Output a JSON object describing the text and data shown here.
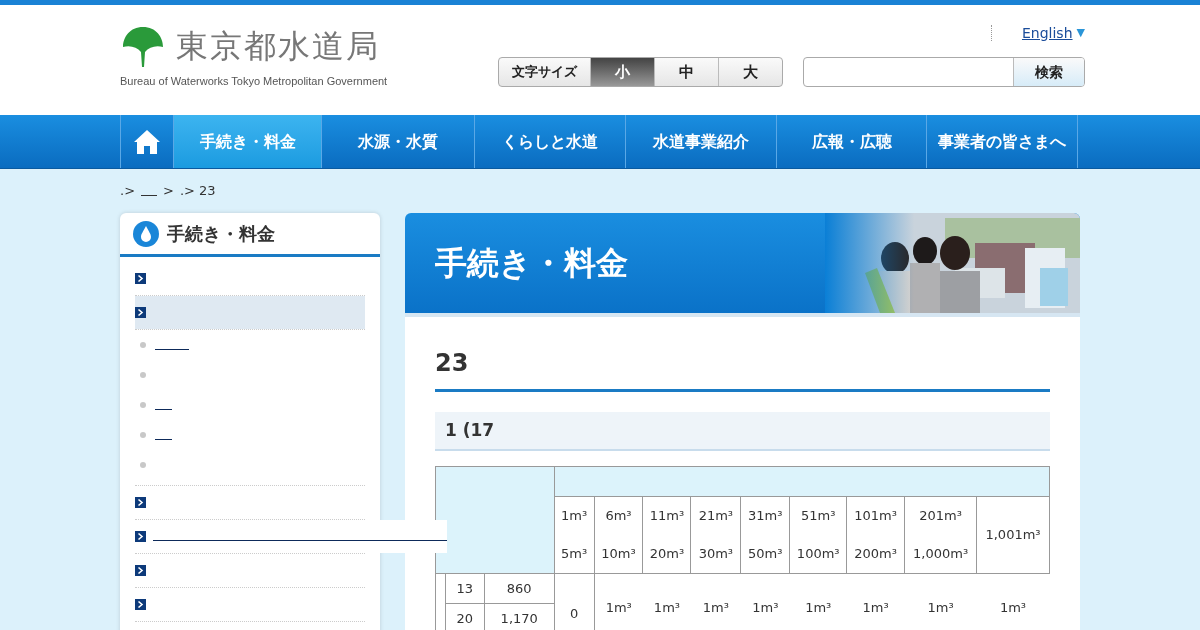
{
  "header": {
    "logo_title": "東京都水道局",
    "logo_subtitle": "Bureau of Waterworks Tokyo Metropolitan Government",
    "language_link": "English",
    "language_caret": "▼",
    "font_size": {
      "label": "文字サイズ",
      "options": [
        {
          "label": "小",
          "selected": true
        },
        {
          "label": "中",
          "selected": false
        },
        {
          "label": "大",
          "selected": false
        }
      ]
    },
    "search": {
      "button": "検索"
    }
  },
  "nav": [
    {
      "label": "手続き・料金",
      "selected": true
    },
    {
      "label": "水源・水質",
      "selected": false
    },
    {
      "label": "くらしと水道",
      "selected": false
    },
    {
      "label": "水道事業紹介",
      "selected": false
    },
    {
      "label": "広報・広聴",
      "selected": false
    },
    {
      "label": "事業者の皆さまへ",
      "selected": false
    }
  ],
  "breadcrumb": [
    ".>",
    ">",
    ".> 23"
  ],
  "sidebar": {
    "title": "手続き・料金",
    "items": [
      {
        "kind": "plain",
        "selected": false
      },
      {
        "kind": "plain",
        "selected": true,
        "children": [
          {
            "kind": "link"
          },
          {
            "kind": "plain"
          },
          {
            "kind": "short-link"
          },
          {
            "kind": "short-link"
          },
          {
            "kind": "plain"
          }
        ]
      },
      {
        "kind": "plain",
        "selected": false
      },
      {
        "kind": "long-link",
        "selected": false
      },
      {
        "kind": "plain",
        "selected": false
      },
      {
        "kind": "plain",
        "selected": false
      }
    ]
  },
  "main": {
    "banner_title": "手続き・料金",
    "heading": "23",
    "subheading": "1 (17",
    "table": {
      "ranges": [
        {
          "from": "1m³",
          "to": "5m³"
        },
        {
          "from": "6m³",
          "to": "10m³"
        },
        {
          "from": "11m³",
          "to": "20m³"
        },
        {
          "from": "21m³",
          "to": "30m³"
        },
        {
          "from": "31m³",
          "to": "50m³"
        },
        {
          "from": "51m³",
          "to": "100m³"
        },
        {
          "from": "101m³",
          "to": "200m³"
        },
        {
          "from": "201m³",
          "to": "1,000m³"
        },
        {
          "from": "1,001m³"
        }
      ],
      "rows": [
        {
          "diameter": "13",
          "base": "860"
        },
        {
          "diameter": "20",
          "base": "1,170"
        }
      ],
      "first_rate": "0",
      "rates": [
        {
          "unit": "1m³"
        },
        {
          "unit": "1m³"
        },
        {
          "unit": "1m³"
        },
        {
          "unit": "1m³"
        },
        {
          "unit": "1m³"
        },
        {
          "unit": "1m³"
        },
        {
          "unit": "1m³"
        },
        {
          "unit": "1m³"
        }
      ]
    }
  }
}
